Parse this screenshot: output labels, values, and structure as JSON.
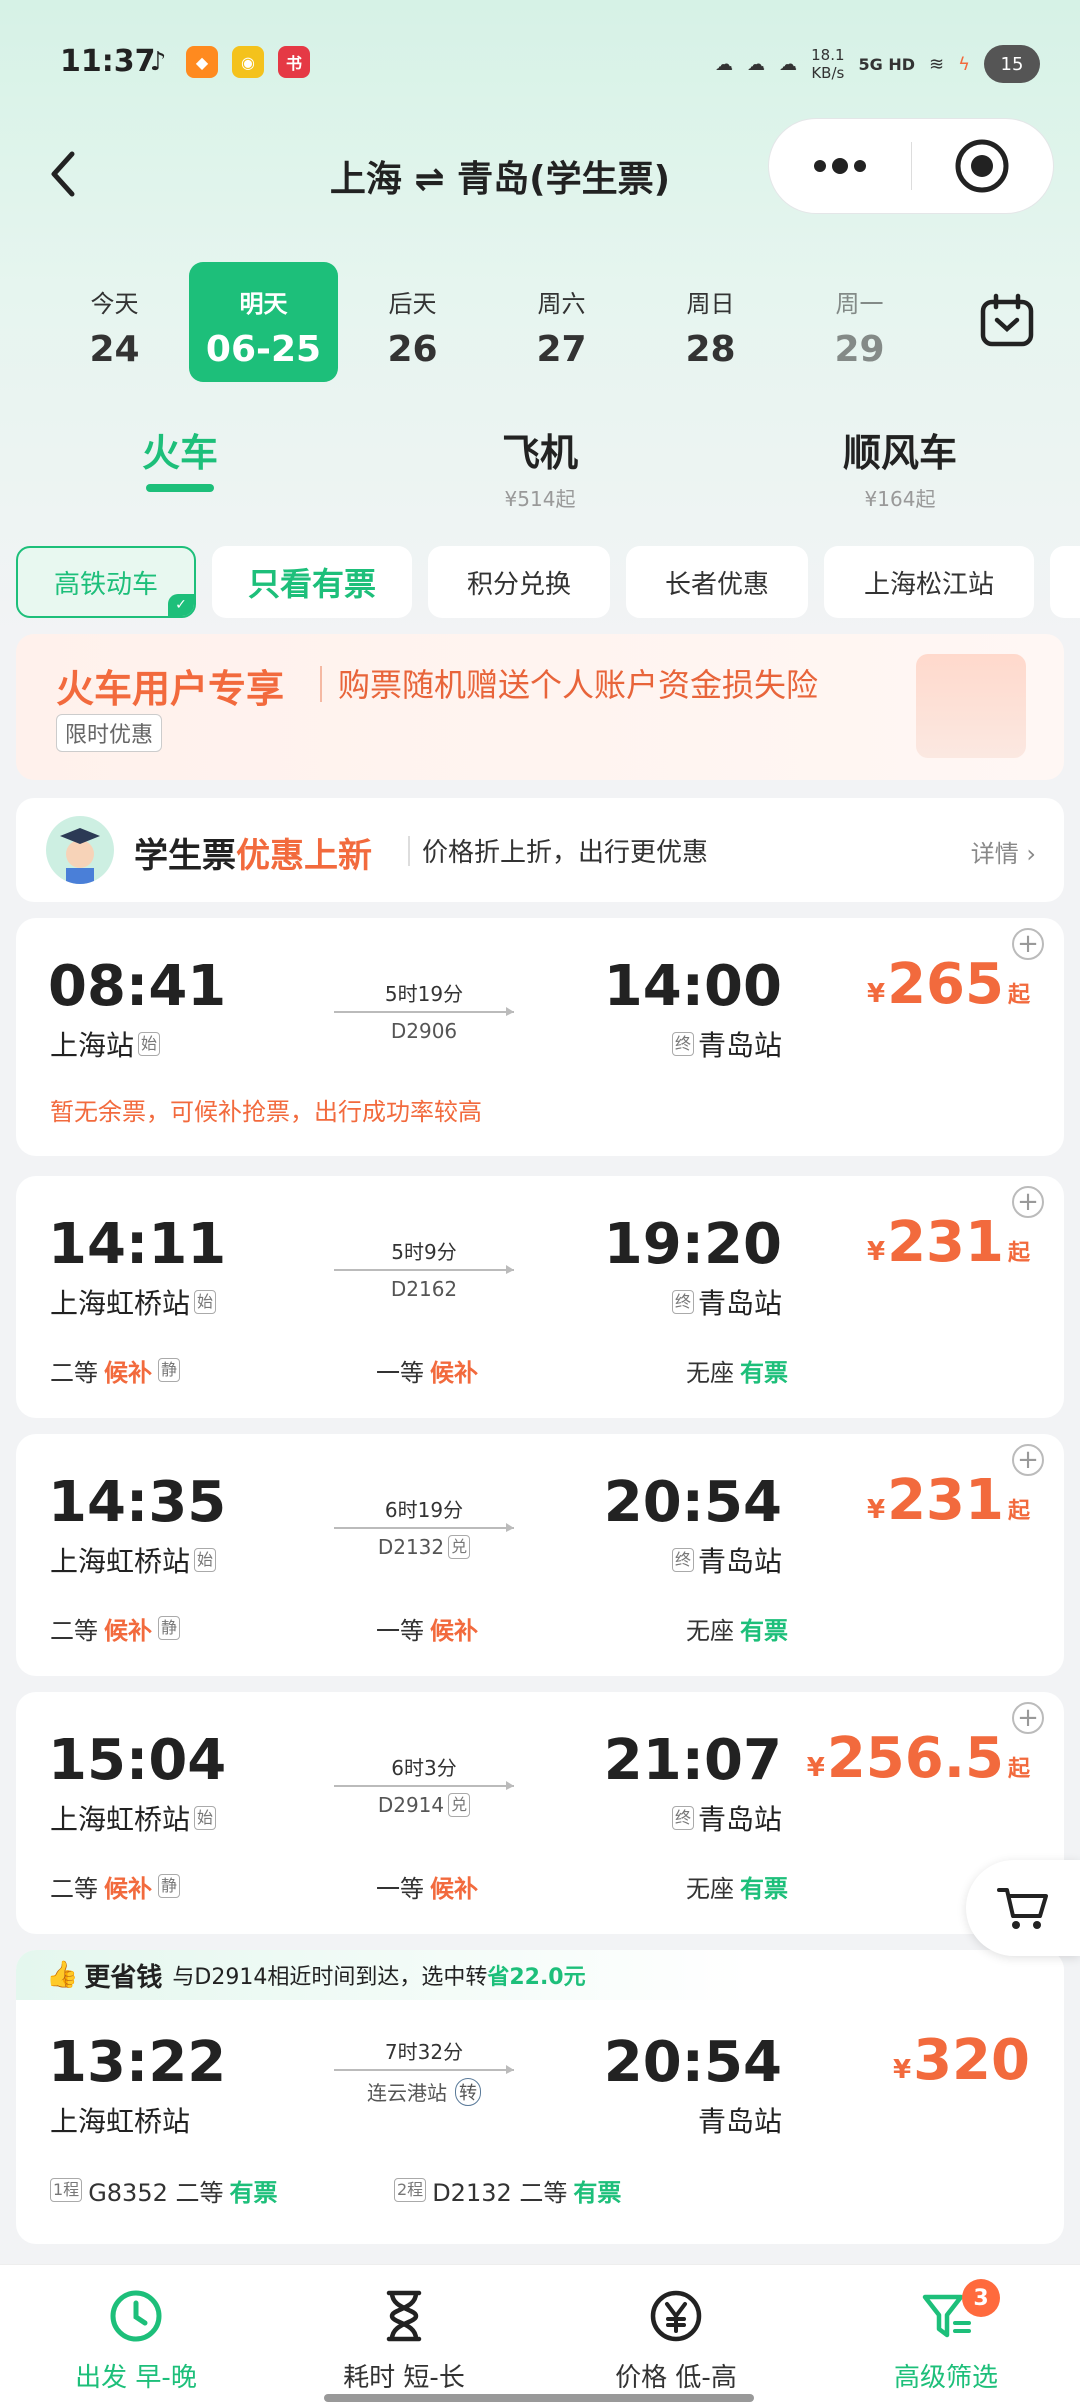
{
  "status_bar": {
    "time": "11:37",
    "net_speed_value": "18.1",
    "net_speed_unit": "KB/s",
    "network": "5G HD",
    "battery": "15"
  },
  "header": {
    "title": "上海 ⇌ 青岛(学生票)"
  },
  "dates": [
    {
      "label": "今天",
      "day": "24"
    },
    {
      "label": "明天",
      "day": "06-25",
      "selected": true
    },
    {
      "label": "后天",
      "day": "26"
    },
    {
      "label": "周六",
      "day": "27"
    },
    {
      "label": "周日",
      "day": "28"
    },
    {
      "label": "周一",
      "day": "29"
    }
  ],
  "modes": [
    {
      "label": "火车",
      "sub": ""
    },
    {
      "label": "飞机",
      "sub": "¥514起"
    },
    {
      "label": "顺风车",
      "sub": "¥164起"
    }
  ],
  "filters": [
    "高铁动车",
    "只看有票",
    "积分兑换",
    "长者优惠",
    "上海松江站"
  ],
  "promo": {
    "title": "火车用户专享",
    "text": "购票随机赠送个人账户资金损失险",
    "tag": "限时优惠"
  },
  "student": {
    "title_a": "学生票",
    "title_b": "优惠上新",
    "desc": "价格折上折，出行更优惠",
    "detail": "详情 ›"
  },
  "trains": [
    {
      "dep_time": "08:41",
      "dep_station": "上海站",
      "dep_tag": "始",
      "duration": "5时19分",
      "train_no": "D2906",
      "arr_time": "14:00",
      "arr_station": "青岛站",
      "arr_tag": "终",
      "currency": "¥",
      "price": "265",
      "price_suffix": "起",
      "notice": "暂无余票，可候补抢票，出行成功率较高"
    },
    {
      "dep_time": "14:11",
      "dep_station": "上海虹桥站",
      "dep_tag": "始",
      "duration": "5时9分",
      "train_no": "D2162",
      "arr_time": "19:20",
      "arr_station": "青岛站",
      "arr_tag": "终",
      "currency": "¥",
      "price": "231",
      "price_suffix": "起",
      "seats": [
        {
          "cls": "二等",
          "status": "候补",
          "extra": "静"
        },
        {
          "cls": "一等",
          "status": "候补"
        },
        {
          "cls": "无座",
          "status": "有票"
        }
      ]
    },
    {
      "dep_time": "14:35",
      "dep_station": "上海虹桥站",
      "dep_tag": "始",
      "duration": "6时19分",
      "train_no": "D2132",
      "no_tag": "兑",
      "arr_time": "20:54",
      "arr_station": "青岛站",
      "arr_tag": "终",
      "currency": "¥",
      "price": "231",
      "price_suffix": "起",
      "seats": [
        {
          "cls": "二等",
          "status": "候补",
          "extra": "静"
        },
        {
          "cls": "一等",
          "status": "候补"
        },
        {
          "cls": "无座",
          "status": "有票"
        }
      ]
    },
    {
      "dep_time": "15:04",
      "dep_station": "上海虹桥站",
      "dep_tag": "始",
      "duration": "6时3分",
      "train_no": "D2914",
      "no_tag": "兑",
      "arr_time": "21:07",
      "arr_station": "青岛站",
      "arr_tag": "终",
      "currency": "¥",
      "price": "256.5",
      "price_suffix": "起",
      "seats": [
        {
          "cls": "二等",
          "status": "候补",
          "extra": "静"
        },
        {
          "cls": "一等",
          "status": "候补"
        },
        {
          "cls": "无座",
          "status": "有票"
        }
      ]
    }
  ],
  "transfer": {
    "head_label": "更省钱",
    "head_text": "与D2914相近时间到达，选中转",
    "head_save": "省22.0元",
    "dep_time": "13:22",
    "dep_station": "上海虹桥站",
    "duration": "7时32分",
    "via": "连云港站",
    "via_tag": "转",
    "arr_time": "20:54",
    "arr_station": "青岛站",
    "currency": "¥",
    "price": "320",
    "leg1_tag": "1程",
    "leg1": "G8352 二等",
    "leg1_status": "有票",
    "leg2_tag": "2程",
    "leg2": "D2132 二等",
    "leg2_status": "有票"
  },
  "bottom_bar": [
    {
      "label": "出发 早-晚",
      "icon": "clock-icon"
    },
    {
      "label": "耗时 短-长",
      "icon": "hourglass-icon"
    },
    {
      "label": "价格 低-高",
      "icon": "yen-icon"
    },
    {
      "label": "高级筛选",
      "icon": "filter-icon",
      "badge": "3"
    }
  ],
  "colors": {
    "accent": "#1dbf7a",
    "price": "#f26a3d"
  }
}
